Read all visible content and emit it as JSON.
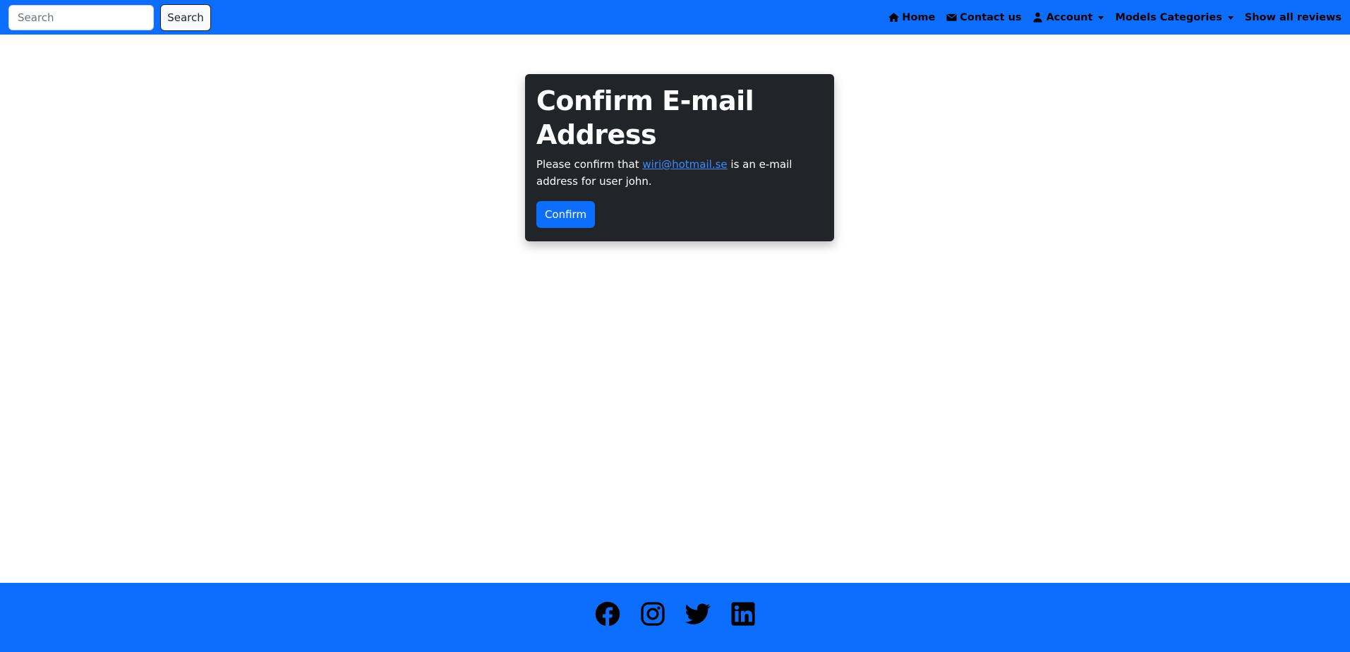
{
  "navbar": {
    "search_placeholder": "Search",
    "search_button": "Search",
    "links": {
      "home": "Home",
      "contact": "Contact us",
      "account": "Account",
      "models_categories": "Models Categories",
      "show_all_reviews": "Show all reviews"
    }
  },
  "card": {
    "title": "Confirm E-mail Address",
    "text_before": "Please confirm that ",
    "email": "wiri@hotmail.se",
    "text_after": " is an e-mail address for user john.",
    "confirm_button": "Confirm"
  },
  "footer": {
    "social_icons": [
      "facebook-icon",
      "instagram-icon",
      "twitter-icon",
      "linkedin-icon"
    ]
  },
  "colors": {
    "primary": "#0d6efd",
    "card_bg": "#212529",
    "link": "#3d8bfd"
  }
}
